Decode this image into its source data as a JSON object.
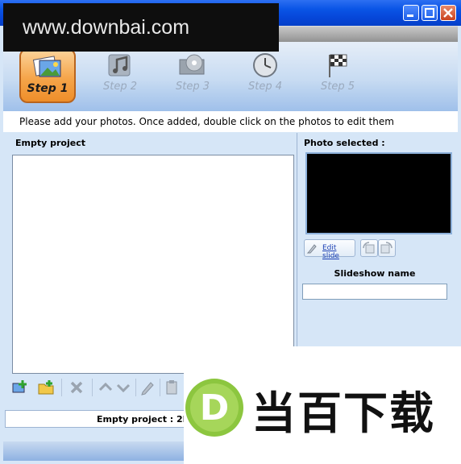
{
  "watermark": {
    "url": "www.downbai.com",
    "logo_letter": "D",
    "logo_text": "当百下载"
  },
  "titlebar": {
    "minimize_icon": "minimize-icon",
    "maximize_icon": "maximize-icon",
    "close_icon": "close-icon"
  },
  "steps": [
    {
      "label": "Step 1",
      "icon": "photos-icon",
      "active": true
    },
    {
      "label": "Step 2",
      "icon": "music-icon",
      "active": false
    },
    {
      "label": "Step 3",
      "icon": "dvd-icon",
      "active": false
    },
    {
      "label": "Step 4",
      "icon": "clock-icon",
      "active": false
    },
    {
      "label": "Step 5",
      "icon": "checkered-flag-icon",
      "active": false
    }
  ],
  "instruction": "Please add your photos. Once added, double click on the photos to edit them",
  "left_panel": {
    "title": "Empty project"
  },
  "toolbar": {
    "add_photos_icon": "add-photos-icon",
    "add_folder_icon": "add-folder-icon",
    "delete_icon": "delete-icon",
    "move_up_icon": "move-up-icon",
    "move_down_icon": "move-down-icon",
    "edit_icon": "pencil-icon",
    "paste_icon": "paste-icon"
  },
  "right_panel": {
    "photo_selected_label": "Photo selected :",
    "edit_slide_label": "Edit slide",
    "slideshow_name_label": "Slideshow name",
    "slideshow_name_value": ""
  },
  "status": {
    "text": "Empty project : 2H"
  },
  "colors": {
    "titlebar": "#0a55e6",
    "panel_bg": "#d6e6f7",
    "active_step": "#f5a54a",
    "link": "#1b3fb3",
    "logo_green": "#8cc63f"
  }
}
